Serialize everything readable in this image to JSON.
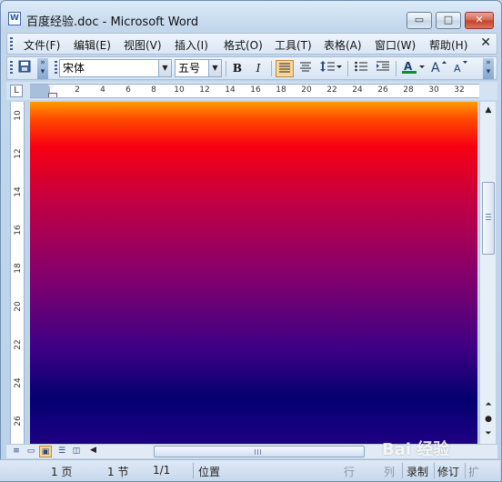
{
  "window": {
    "title": "百度经验.doc - Microsoft Word",
    "app_icon_letter": "W",
    "controls": {
      "minimize": "▭",
      "maximize": "□",
      "close": "✕"
    }
  },
  "menubar": {
    "items": [
      "文件(F)",
      "编辑(E)",
      "视图(V)",
      "插入(I)",
      "格式(O)",
      "工具(T)",
      "表格(A)",
      "窗口(W)",
      "帮助(H)"
    ],
    "close_doc": "✕"
  },
  "toolbar": {
    "font_name": "宋体",
    "font_size": "五号",
    "bold": "B",
    "italic": "I",
    "icons": [
      "save-icon",
      "align-left-icon",
      "align-justify-icon",
      "line-spacing-icon",
      "bullet-list-icon",
      "indent-icon",
      "font-color-icon",
      "grow-font-icon",
      "shrink-font-icon"
    ],
    "accent_color": "#0c8f2f"
  },
  "ruler": {
    "corner_symbol": "L",
    "labels": [
      "2",
      "4",
      "6",
      "8",
      "10",
      "12",
      "14",
      "16",
      "18",
      "20",
      "22",
      "24",
      "26",
      "28",
      "30",
      "32"
    ]
  },
  "vruler": {
    "labels": [
      "10",
      "12",
      "14",
      "16",
      "18",
      "20",
      "22",
      "24",
      "26"
    ]
  },
  "document": {
    "gradient_colors": [
      "#ff9b00",
      "#ff4a00",
      "#f70012",
      "#c00044",
      "#80006e",
      "#3e0085",
      "#030070",
      "#1e0083"
    ]
  },
  "statusbar": {
    "page": "1 页",
    "section": "1 节",
    "page_of": "1/1",
    "position": "位置",
    "line": "行",
    "column": "列",
    "record": "录制",
    "revise": "修订",
    "extend": "扩"
  },
  "watermark": {
    "text": "Bai 经验"
  }
}
